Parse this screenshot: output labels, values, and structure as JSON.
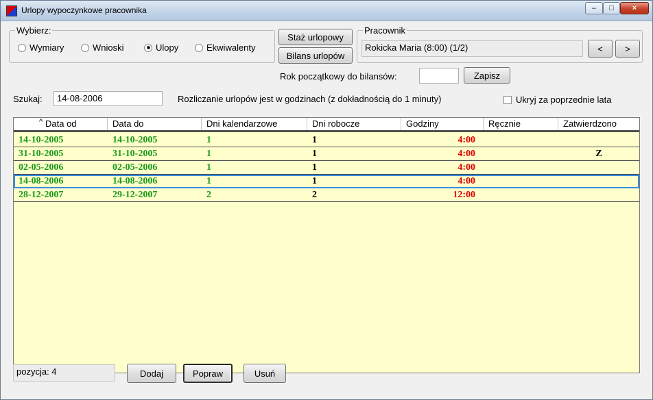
{
  "window": {
    "title": "Urlopy wypoczynkowe pracownika",
    "minimize": "–",
    "maximize": "□",
    "close": "×"
  },
  "wybierz": {
    "legend": "Wybierz:",
    "options": [
      {
        "label": "Wymiary",
        "selected": false
      },
      {
        "label": "Wnioski",
        "selected": false
      },
      {
        "label": "Ulopy",
        "selected": true
      },
      {
        "label": "Ekwiwalenty",
        "selected": false
      }
    ]
  },
  "buttons": {
    "staz": "Staż urlopowy",
    "bilans": "Bilans urlopów",
    "prev": "<",
    "next": ">",
    "zapisz": "Zapisz",
    "dodaj": "Dodaj",
    "popraw": "Popraw",
    "usun": "Usuń"
  },
  "pracownik": {
    "legend": "Pracownik",
    "value": "Rokicka Maria  (8:00)  (1/2)"
  },
  "rok": {
    "label": "Rok początkowy do bilansów:",
    "value": ""
  },
  "search": {
    "label": "Szukaj:",
    "value": "14-08-2006"
  },
  "info_text": "Rozliczanie urlopów jest w godzinach (z dokładnością do 1 minuty)",
  "ukryj": {
    "label": "Ukryj za poprzednie lata",
    "checked": false
  },
  "table": {
    "columns": [
      "Data od",
      "Data do",
      "Dni kalendarzowe",
      "Dni robocze",
      "Godziny",
      "Ręcznie",
      "Zatwierdzono"
    ],
    "sort_indicator": "^",
    "rows": [
      {
        "od": "14-10-2005",
        "do": "14-10-2005",
        "kal": "1",
        "rob": "1",
        "godz": "4:00",
        "recznie": "",
        "zatw": ""
      },
      {
        "od": "31-10-2005",
        "do": "31-10-2005",
        "kal": "1",
        "rob": "1",
        "godz": "4:00",
        "recznie": "",
        "zatw": "Z"
      },
      {
        "od": "02-05-2006",
        "do": "02-05-2006",
        "kal": "1",
        "rob": "1",
        "godz": "4:00",
        "recznie": "",
        "zatw": ""
      },
      {
        "od": "14-08-2006",
        "do": "14-08-2006",
        "kal": "1",
        "rob": "1",
        "godz": "4:00",
        "recznie": "",
        "zatw": ""
      },
      {
        "od": "28-12-2007",
        "do": "29-12-2007",
        "kal": "2",
        "rob": "2",
        "godz": "12:00",
        "recznie": "",
        "zatw": ""
      }
    ],
    "selected_row": 3
  },
  "status": {
    "pozycja": "pozycja:  4"
  },
  "colors": {
    "row_bg": "#ffffcc",
    "date_green": "#1a9a1a",
    "hours_red": "#e00000",
    "selection": "#3a8ee0"
  }
}
